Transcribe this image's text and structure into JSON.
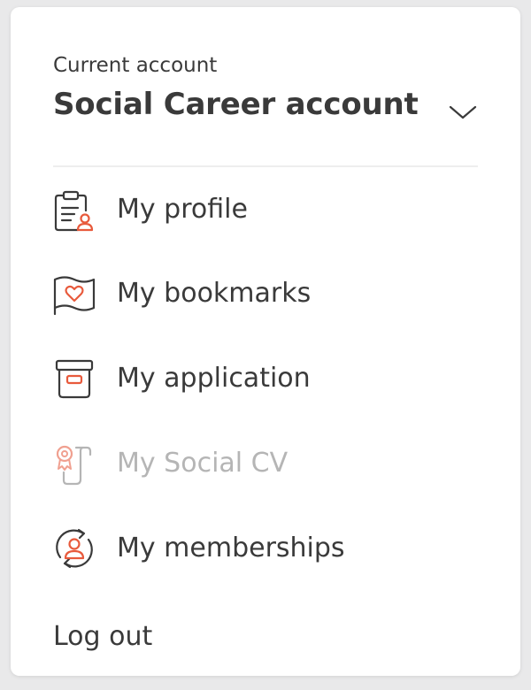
{
  "colors": {
    "text": "#3a3a3a",
    "accent": "#e85a3c",
    "disabled": "#b5b5b5",
    "divider": "#eeeeee",
    "background": "#ffffff"
  },
  "account": {
    "caption": "Current account",
    "name": "Social Career account"
  },
  "menu": {
    "items": [
      {
        "label": "My profile",
        "icon": "profile-clipboard-icon",
        "enabled": true
      },
      {
        "label": "My bookmarks",
        "icon": "bookmark-heart-flag-icon",
        "enabled": true
      },
      {
        "label": "My application",
        "icon": "archive-box-icon",
        "enabled": true
      },
      {
        "label": "My Social CV",
        "icon": "certificate-scroll-icon",
        "enabled": false
      },
      {
        "label": "My memberships",
        "icon": "membership-refresh-user-icon",
        "enabled": true
      }
    ]
  },
  "logout": {
    "label": "Log out"
  }
}
